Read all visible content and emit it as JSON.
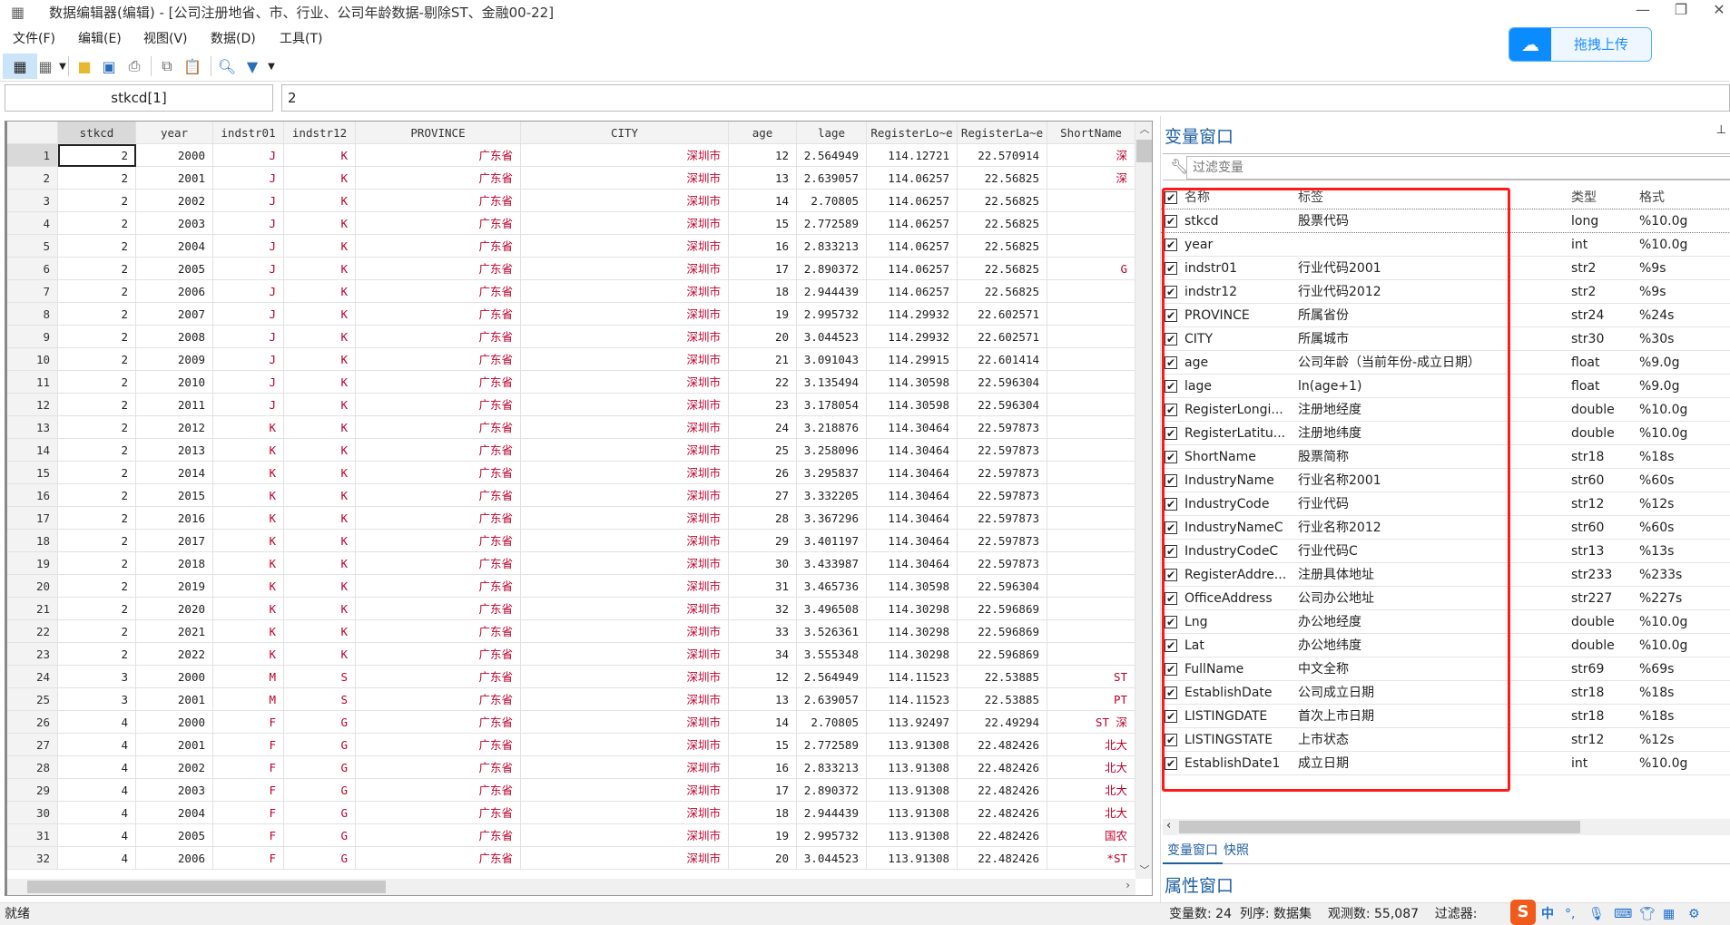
{
  "window": {
    "title": "数据编辑器(编辑) - [公司注册地省、市、行业、公司年龄数据-剔除ST、金融00-22]"
  },
  "menu": [
    "文件(F)",
    "编辑(E)",
    "视图(V)",
    "数据(D)",
    "工具(T)"
  ],
  "toolbar": {
    "icons": [
      "edit-mode-icon",
      "browse-mode-icon",
      "open-icon",
      "save-icon",
      "print-icon",
      "copy-icon",
      "paste-icon",
      "find-icon",
      "filter-icon"
    ]
  },
  "upload": {
    "label": "拖拽上传",
    "icon": "cloud-icon",
    "color": "#0a8cff"
  },
  "cellbar": {
    "name": "stkcd[1]",
    "value": "2"
  },
  "grid": {
    "columns": [
      "",
      "stkcd",
      "year",
      "indstr01",
      "indstr12",
      "PROVINCE",
      "CITY",
      "age",
      "lage",
      "RegisterLo~e",
      "RegisterLa~e",
      "ShortName"
    ],
    "string_color": "#c0002a",
    "rows": [
      [
        "1",
        "2",
        "2000",
        "J",
        "K",
        "广东省",
        "深圳市",
        "12",
        "2.564949",
        "114.12721",
        "22.570914",
        "深"
      ],
      [
        "2",
        "2",
        "2001",
        "J",
        "K",
        "广东省",
        "深圳市",
        "13",
        "2.639057",
        "114.06257",
        "22.56825",
        "深"
      ],
      [
        "3",
        "2",
        "2002",
        "J",
        "K",
        "广东省",
        "深圳市",
        "14",
        "2.70805",
        "114.06257",
        "22.56825",
        ""
      ],
      [
        "4",
        "2",
        "2003",
        "J",
        "K",
        "广东省",
        "深圳市",
        "15",
        "2.772589",
        "114.06257",
        "22.56825",
        ""
      ],
      [
        "5",
        "2",
        "2004",
        "J",
        "K",
        "广东省",
        "深圳市",
        "16",
        "2.833213",
        "114.06257",
        "22.56825",
        ""
      ],
      [
        "6",
        "2",
        "2005",
        "J",
        "K",
        "广东省",
        "深圳市",
        "17",
        "2.890372",
        "114.06257",
        "22.56825",
        "G"
      ],
      [
        "7",
        "2",
        "2006",
        "J",
        "K",
        "广东省",
        "深圳市",
        "18",
        "2.944439",
        "114.06257",
        "22.56825",
        ""
      ],
      [
        "8",
        "2",
        "2007",
        "J",
        "K",
        "广东省",
        "深圳市",
        "19",
        "2.995732",
        "114.29932",
        "22.602571",
        ""
      ],
      [
        "9",
        "2",
        "2008",
        "J",
        "K",
        "广东省",
        "深圳市",
        "20",
        "3.044523",
        "114.29932",
        "22.602571",
        ""
      ],
      [
        "10",
        "2",
        "2009",
        "J",
        "K",
        "广东省",
        "深圳市",
        "21",
        "3.091043",
        "114.29915",
        "22.601414",
        ""
      ],
      [
        "11",
        "2",
        "2010",
        "J",
        "K",
        "广东省",
        "深圳市",
        "22",
        "3.135494",
        "114.30598",
        "22.596304",
        ""
      ],
      [
        "12",
        "2",
        "2011",
        "J",
        "K",
        "广东省",
        "深圳市",
        "23",
        "3.178054",
        "114.30598",
        "22.596304",
        ""
      ],
      [
        "13",
        "2",
        "2012",
        "K",
        "K",
        "广东省",
        "深圳市",
        "24",
        "3.218876",
        "114.30464",
        "22.597873",
        ""
      ],
      [
        "14",
        "2",
        "2013",
        "K",
        "K",
        "广东省",
        "深圳市",
        "25",
        "3.258096",
        "114.30464",
        "22.597873",
        ""
      ],
      [
        "15",
        "2",
        "2014",
        "K",
        "K",
        "广东省",
        "深圳市",
        "26",
        "3.295837",
        "114.30464",
        "22.597873",
        ""
      ],
      [
        "16",
        "2",
        "2015",
        "K",
        "K",
        "广东省",
        "深圳市",
        "27",
        "3.332205",
        "114.30464",
        "22.597873",
        ""
      ],
      [
        "17",
        "2",
        "2016",
        "K",
        "K",
        "广东省",
        "深圳市",
        "28",
        "3.367296",
        "114.30464",
        "22.597873",
        ""
      ],
      [
        "18",
        "2",
        "2017",
        "K",
        "K",
        "广东省",
        "深圳市",
        "29",
        "3.401197",
        "114.30464",
        "22.597873",
        ""
      ],
      [
        "19",
        "2",
        "2018",
        "K",
        "K",
        "广东省",
        "深圳市",
        "30",
        "3.433987",
        "114.30464",
        "22.597873",
        ""
      ],
      [
        "20",
        "2",
        "2019",
        "K",
        "K",
        "广东省",
        "深圳市",
        "31",
        "3.465736",
        "114.30598",
        "22.596304",
        ""
      ],
      [
        "21",
        "2",
        "2020",
        "K",
        "K",
        "广东省",
        "深圳市",
        "32",
        "3.496508",
        "114.30298",
        "22.596869",
        ""
      ],
      [
        "22",
        "2",
        "2021",
        "K",
        "K",
        "广东省",
        "深圳市",
        "33",
        "3.526361",
        "114.30298",
        "22.596869",
        ""
      ],
      [
        "23",
        "2",
        "2022",
        "K",
        "K",
        "广东省",
        "深圳市",
        "34",
        "3.555348",
        "114.30298",
        "22.596869",
        ""
      ],
      [
        "24",
        "3",
        "2000",
        "M",
        "S",
        "广东省",
        "深圳市",
        "12",
        "2.564949",
        "114.11523",
        "22.53885",
        "ST"
      ],
      [
        "25",
        "3",
        "2001",
        "M",
        "S",
        "广东省",
        "深圳市",
        "13",
        "2.639057",
        "114.11523",
        "22.53885",
        "PT"
      ],
      [
        "26",
        "4",
        "2000",
        "F",
        "G",
        "广东省",
        "深圳市",
        "14",
        "2.70805",
        "113.92497",
        "22.49294",
        "ST 深"
      ],
      [
        "27",
        "4",
        "2001",
        "F",
        "G",
        "广东省",
        "深圳市",
        "15",
        "2.772589",
        "113.91308",
        "22.482426",
        "北大"
      ],
      [
        "28",
        "4",
        "2002",
        "F",
        "G",
        "广东省",
        "深圳市",
        "16",
        "2.833213",
        "113.91308",
        "22.482426",
        "北大"
      ],
      [
        "29",
        "4",
        "2003",
        "F",
        "G",
        "广东省",
        "深圳市",
        "17",
        "2.890372",
        "113.91308",
        "22.482426",
        "北大"
      ],
      [
        "30",
        "4",
        "2004",
        "F",
        "G",
        "广东省",
        "深圳市",
        "18",
        "2.944439",
        "113.91308",
        "22.482426",
        "北大"
      ],
      [
        "31",
        "4",
        "2005",
        "F",
        "G",
        "广东省",
        "深圳市",
        "19",
        "2.995732",
        "113.91308",
        "22.482426",
        "国农"
      ],
      [
        "32",
        "4",
        "2006",
        "F",
        "G",
        "广东省",
        "深圳市",
        "20",
        "3.044523",
        "113.91308",
        "22.482426",
        "*ST"
      ]
    ]
  },
  "varwindow": {
    "title": "变量窗口",
    "filter_placeholder": "过滤变量",
    "headers": {
      "name": "名称",
      "label": "标签",
      "type": "类型",
      "format": "格式"
    },
    "vars": [
      [
        "stkcd",
        "股票代码",
        "long",
        "%10.0g"
      ],
      [
        "year",
        "",
        "int",
        "%10.0g"
      ],
      [
        "indstr01",
        "行业代码2001",
        "str2",
        "%9s"
      ],
      [
        "indstr12",
        "行业代码2012",
        "str2",
        "%9s"
      ],
      [
        "PROVINCE",
        "所属省份",
        "str24",
        "%24s"
      ],
      [
        "CITY",
        "所属城市",
        "str30",
        "%30s"
      ],
      [
        "age",
        "公司年龄（当前年份-成立日期）",
        "float",
        "%9.0g"
      ],
      [
        "lage",
        "ln(age+1)",
        "float",
        "%9.0g"
      ],
      [
        "RegisterLongi...",
        "注册地经度",
        "double",
        "%10.0g"
      ],
      [
        "RegisterLatitu...",
        "注册地纬度",
        "double",
        "%10.0g"
      ],
      [
        "ShortName",
        "股票简称",
        "str18",
        "%18s"
      ],
      [
        "IndustryName",
        "行业名称2001",
        "str60",
        "%60s"
      ],
      [
        "IndustryCode",
        "行业代码",
        "str12",
        "%12s"
      ],
      [
        "IndustryNameC",
        "行业名称2012",
        "str60",
        "%60s"
      ],
      [
        "IndustryCodeC",
        "行业代码C",
        "str13",
        "%13s"
      ],
      [
        "RegisterAddre...",
        "注册具体地址",
        "str233",
        "%233s"
      ],
      [
        "OfficeAddress",
        "公司办公地址",
        "str227",
        "%227s"
      ],
      [
        "Lng",
        "办公地经度",
        "double",
        "%10.0g"
      ],
      [
        "Lat",
        "办公地纬度",
        "double",
        "%10.0g"
      ],
      [
        "FullName",
        "中文全称",
        "str69",
        "%69s"
      ],
      [
        "EstablishDate",
        "公司成立日期",
        "str18",
        "%18s"
      ],
      [
        "LISTINGDATE",
        "首次上市日期",
        "str18",
        "%18s"
      ],
      [
        "LISTINGSTATE",
        "上市状态",
        "str12",
        "%12s"
      ],
      [
        "EstablishDate1",
        "成立日期",
        "int",
        "%10.0g"
      ]
    ],
    "tabs": [
      "变量窗口",
      "快照"
    ],
    "highlight_color": "#ff1a1a"
  },
  "propwindow": {
    "title": "属性窗口"
  },
  "status": {
    "left": "就绪",
    "right": "变量数: 24  列序: 数据集    观测数: 55,087    过滤器:"
  }
}
